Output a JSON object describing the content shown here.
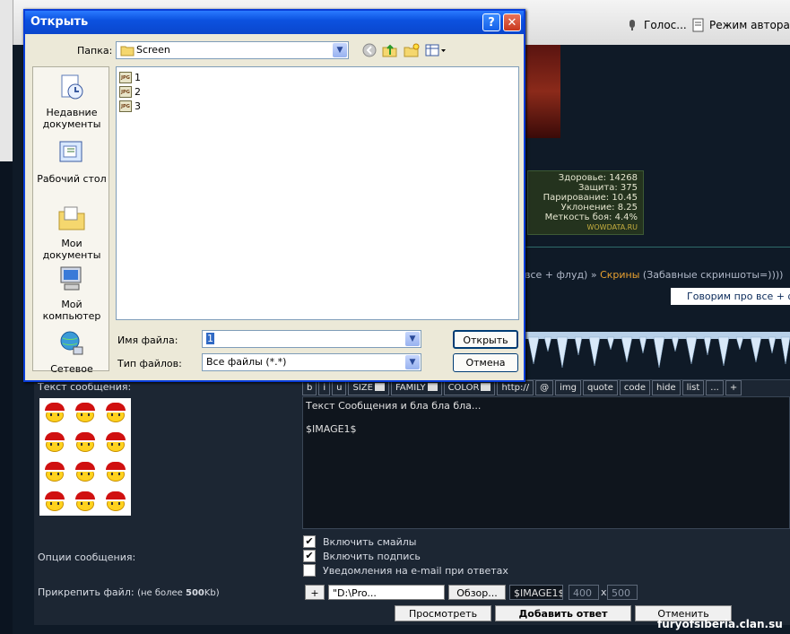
{
  "browser": {
    "toolbar_voice": "Голос...",
    "toolbar_author_mode": "Режим автора"
  },
  "forum": {
    "stats": {
      "rows": [
        {
          "label": "Здоровье:",
          "value": "14268"
        },
        {
          "label": "Защита:",
          "value": "375"
        },
        {
          "label": "Парирование:",
          "value": "10.45"
        },
        {
          "label": "Уклонение:",
          "value": "8.25"
        },
        {
          "label": "Меткость боя:",
          "value": "4.4%"
        }
      ],
      "brand": "WOWDATA.RU"
    },
    "breadcrumb_prefix": "все + флуд) » ",
    "breadcrumb_link": "Скрины",
    "breadcrumb_suffix": " (Забавные скриншоты=))))",
    "topic_box": "Говорим про все + фл",
    "message_label": "Текст сообщения:",
    "bbcode_buttons": [
      "b",
      "i",
      "u",
      "SIZE",
      "FAMILY",
      "COLOR",
      "http://",
      "@",
      "img",
      "quote",
      "code",
      "hide",
      "list",
      "...",
      "+"
    ],
    "message_text": "Текст Сообщения и бла бла бла...\n\n$IMAGE1$",
    "options_label": "Опции сообщения:",
    "options": [
      {
        "label": "Включить смайлы",
        "checked": true
      },
      {
        "label": "Включить подпись",
        "checked": true
      },
      {
        "label": "Уведомления на e-mail при ответах",
        "checked": false
      }
    ],
    "attach_label": "Прикрепить файл:",
    "attach_limit_prefix": "(не более ",
    "attach_limit_value": "500",
    "attach_limit_suffix": "Kb)",
    "attach_plus": "+",
    "attach_path": "\"D:\\Рro...",
    "browse_button": "Обзор...",
    "image_tag": "$IMAGE1$",
    "width_value": "400",
    "times": "x",
    "height_value": "500",
    "preview_button": "Просмотреть",
    "add_reply_button": "Добавить ответ",
    "cancel_button": "Отменить",
    "watermark": "furyofsiberia.clan.su"
  },
  "dialog": {
    "title": "Открыть",
    "help": "?",
    "close": "✕",
    "folder_label": "Папка:",
    "folder_value": "Screen",
    "places": [
      {
        "label": "Недавние документы",
        "icon": "recent-documents-icon"
      },
      {
        "label": "Рабочий стол",
        "icon": "desktop-icon"
      },
      {
        "label": "Мои документы",
        "icon": "my-documents-icon"
      },
      {
        "label": "Мой компьютер",
        "icon": "my-computer-icon"
      },
      {
        "label": "Сетевое",
        "icon": "network-icon"
      }
    ],
    "files": [
      {
        "name": "1",
        "type": "JPG"
      },
      {
        "name": "2",
        "type": "JPG"
      },
      {
        "name": "3",
        "type": "JPG"
      }
    ],
    "filename_label": "Имя файла:",
    "filename_value": "1",
    "filetype_label": "Тип файлов:",
    "filetype_value": "Все файлы (*.*)",
    "open_button": "Открыть",
    "cancel_button": "Отмена"
  }
}
